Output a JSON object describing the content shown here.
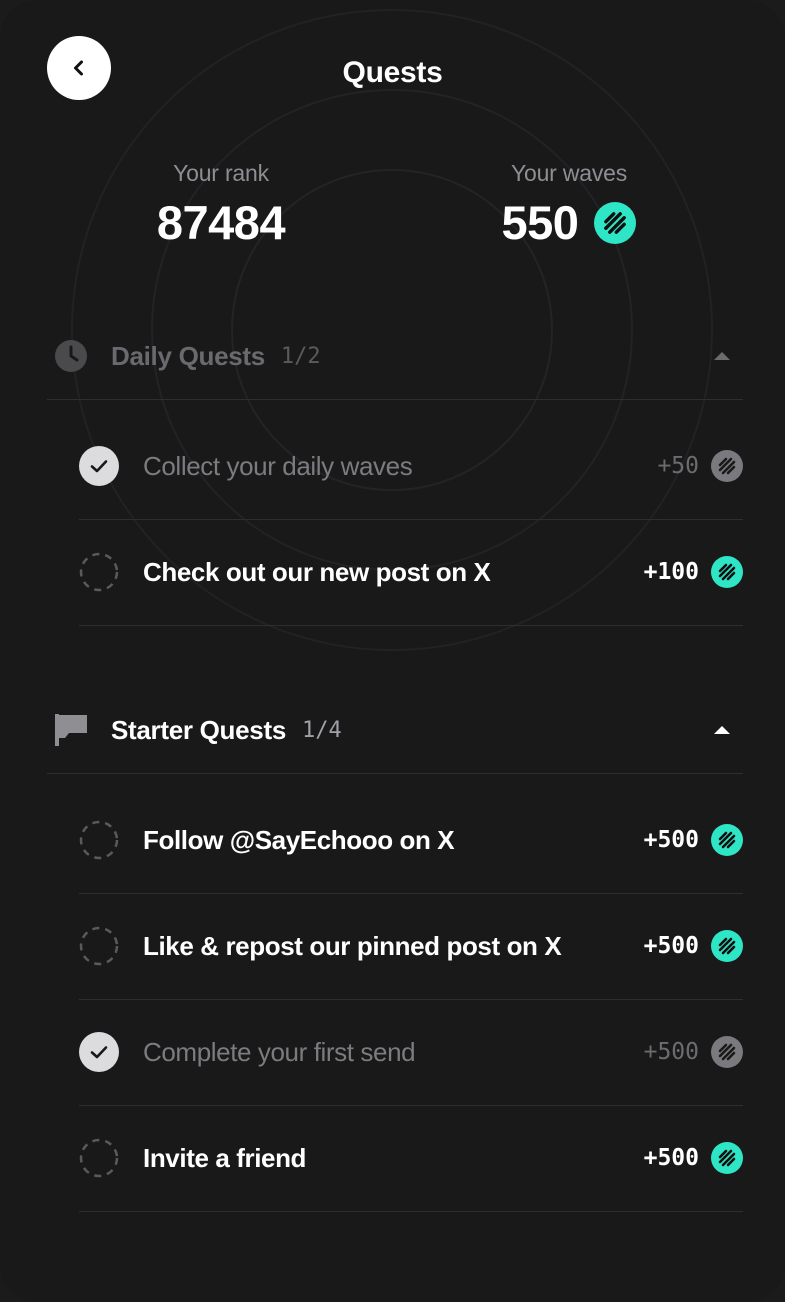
{
  "header": {
    "title": "Quests",
    "back_icon": "chevron-left-icon"
  },
  "stats": {
    "rank_label": "Your rank",
    "rank_value": "87484",
    "waves_label": "Your waves",
    "waves_value": "550",
    "waves_icon": "waves-icon"
  },
  "colors": {
    "accent": "#2ee6c5",
    "done_icon": "#7a7a7e",
    "background": "#19191a"
  },
  "daily": {
    "icon": "clock-icon",
    "title": "Daily Quests",
    "count": "1/2",
    "toggle_icon": "caret-up-icon",
    "items": [
      {
        "label": "Collect your daily waves",
        "points": "+50",
        "done": true
      },
      {
        "label": "Check out our new post on X",
        "points": "+100",
        "done": false
      }
    ]
  },
  "starter": {
    "icon": "flag-icon",
    "title": "Starter Quests",
    "count": "1/4",
    "toggle_icon": "caret-up-icon",
    "items": [
      {
        "label": "Follow @SayEchooo on X",
        "points": "+500",
        "done": false
      },
      {
        "label": "Like & repost our pinned post on X",
        "points": "+500",
        "done": false
      },
      {
        "label": "Complete your first send",
        "points": "+500",
        "done": true
      },
      {
        "label": "Invite a friend",
        "points": "+500",
        "done": false
      }
    ]
  }
}
